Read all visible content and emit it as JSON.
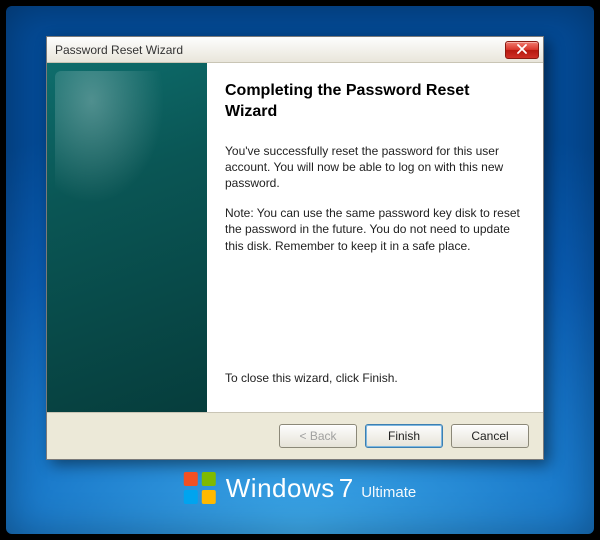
{
  "desktop": {
    "brand": "Windows",
    "version": "7",
    "edition": "Ultimate"
  },
  "wizard": {
    "title": "Password Reset Wizard",
    "heading": "Completing the Password Reset Wizard",
    "body1": "You've successfully reset the password for this user account. You will now be able to log on with this new password.",
    "body2": "Note: You can use the same password key disk to reset the password in the future. You do not need to update this disk. Remember to keep it in a safe place.",
    "closeInstruction": "To close this wizard, click Finish.",
    "buttons": {
      "back": "< Back",
      "finish": "Finish",
      "cancel": "Cancel"
    }
  }
}
